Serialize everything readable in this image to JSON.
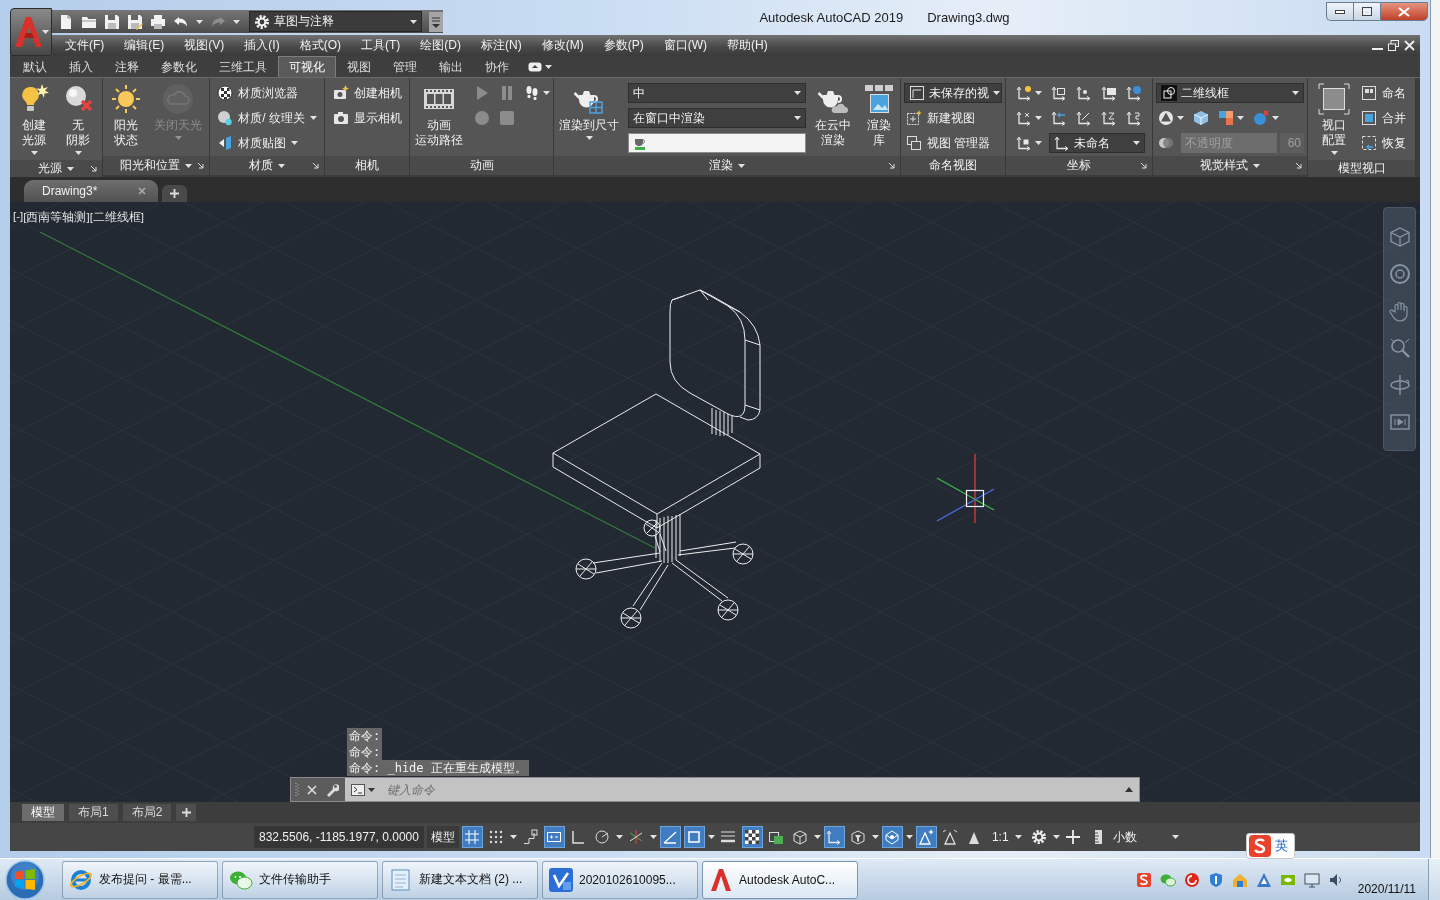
{
  "window": {
    "app_title": "Autodesk AutoCAD 2019",
    "file_title": "Drawing3.dwg"
  },
  "quick_access": {
    "workspace": "草图与注释"
  },
  "menu_bar": [
    "文件(F)",
    "编辑(E)",
    "视图(V)",
    "插入(I)",
    "格式(O)",
    "工具(T)",
    "绘图(D)",
    "标注(N)",
    "修改(M)",
    "参数(P)",
    "窗口(W)",
    "帮助(H)"
  ],
  "ribbon_tabs": [
    {
      "label": "默认",
      "selected": false
    },
    {
      "label": "插入",
      "selected": false
    },
    {
      "label": "注释",
      "selected": false
    },
    {
      "label": "参数化",
      "selected": false
    },
    {
      "label": "三维工具",
      "selected": false
    },
    {
      "label": "可视化",
      "selected": true
    },
    {
      "label": "视图",
      "selected": false
    },
    {
      "label": "管理",
      "selected": false
    },
    {
      "label": "输出",
      "selected": false
    },
    {
      "label": "协作",
      "selected": false
    }
  ],
  "ribbon_panels": [
    {
      "title": "光源",
      "menu": true,
      "launcher": true,
      "columns": [
        {
          "kind": "large",
          "lines": [
            "创建",
            "光源"
          ],
          "caret": true
        },
        {
          "kind": "large",
          "lines": [
            "无",
            "阴影"
          ],
          "caret": true
        }
      ]
    },
    {
      "title": "阳光和位置",
      "menu": true,
      "launcher": true,
      "columns": [
        {
          "kind": "large",
          "lines": [
            "阳光",
            "状态"
          ],
          "caret": false,
          "disabled": false
        },
        {
          "kind": "large",
          "lines": [
            "关闭天光"
          ],
          "caret": true,
          "disabled": true
        }
      ]
    },
    {
      "title": "材质",
      "menu": true,
      "launcher": true,
      "columns": [
        {
          "kind": "stack",
          "rows": [
            {
              "items": [
                {
                  "kind": "button",
                  "label": "材质浏览器",
                  "caret": false
                }
              ]
            },
            {
              "items": [
                {
                  "kind": "button",
                  "label": "材质/ 纹理关",
                  "caret": true
                }
              ]
            },
            {
              "items": [
                {
                  "kind": "button",
                  "label": "材质贴图",
                  "caret": true
                }
              ]
            }
          ]
        }
      ]
    },
    {
      "title": "相机",
      "menu": false,
      "launcher": false,
      "columns": [
        {
          "kind": "stack",
          "rows": [
            {
              "items": [
                {
                  "kind": "button",
                  "label": "创建相机",
                  "caret": false
                }
              ]
            },
            {
              "items": [
                {
                  "kind": "button",
                  "label": "显示相机",
                  "caret": false
                }
              ]
            }
          ]
        }
      ]
    },
    {
      "title": "动画",
      "menu": false,
      "launcher": false,
      "columns": [
        {
          "kind": "large",
          "lines": [
            "动画",
            "运动路径"
          ],
          "caret": false
        },
        {
          "kind": "stack",
          "rows": [
            {
              "items": [
                {
                  "kind": "button",
                  "caret": false,
                  "disabled": true
                },
                {
                  "kind": "button",
                  "caret": false,
                  "disabled": true
                },
                {
                  "kind": "button",
                  "caret": true,
                  "disabled": false
                }
              ]
            },
            {
              "items": [
                {
                  "kind": "button",
                  "caret": false,
                  "disabled": true
                },
                {
                  "kind": "button",
                  "caret": false,
                  "disabled": true
                }
              ]
            }
          ]
        }
      ]
    },
    {
      "title": "渲染",
      "menu": true,
      "launcher": true,
      "columns": [
        {
          "kind": "large",
          "lines": [
            "渲染到尺寸"
          ],
          "caret": true
        },
        {
          "kind": "stack",
          "rows": [
            {
              "items": [
                {
                  "kind": "dropdown",
                  "value": "中"
                }
              ]
            },
            {
              "items": [
                {
                  "kind": "dropdown",
                  "value": "在窗口中渲染"
                }
              ]
            },
            {
              "items": [
                {
                  "kind": "input"
                }
              ]
            }
          ]
        },
        {
          "kind": "large",
          "lines": [
            "在云中",
            "渲染"
          ],
          "caret": false
        },
        {
          "kind": "large",
          "lines": [
            "渲染",
            "库"
          ],
          "caret": false
        }
      ]
    },
    {
      "title": "命名视图",
      "menu": false,
      "launcher": false,
      "columns": [
        {
          "kind": "stack",
          "rows": [
            {
              "items": [
                {
                  "kind": "dropdown",
                  "value": "未保存的视"
                }
              ]
            },
            {
              "items": [
                {
                  "kind": "button",
                  "label": "新建视图",
                  "caret": false
                }
              ]
            },
            {
              "items": [
                {
                  "kind": "button",
                  "label": "视图 管理器",
                  "caret": false
                }
              ]
            }
          ]
        }
      ]
    },
    {
      "title": "坐标",
      "menu": false,
      "launcher": true,
      "columns": [
        {
          "kind": "stack",
          "rows": [
            {
              "items": [
                {
                  "kind": "button",
                  "caret": true
                },
                {
                  "kind": "button",
                  "caret": false
                },
                {
                  "kind": "button",
                  "caret": false
                },
                {
                  "kind": "button",
                  "caret": false
                },
                {
                  "kind": "button",
                  "caret": false
                }
              ]
            },
            {
              "items": [
                {
                  "kind": "button",
                  "caret": true
                },
                {
                  "kind": "button",
                  "caret": false
                },
                {
                  "kind": "button",
                  "caret": false
                },
                {
                  "kind": "button",
                  "caret": false
                },
                {
                  "kind": "button",
                  "caret": false
                }
              ]
            },
            {
              "items": [
                {
                  "kind": "button",
                  "caret": true
                },
                {
                  "kind": "dropdown",
                  "value": "未命名"
                }
              ]
            }
          ]
        }
      ]
    },
    {
      "title": "视觉样式",
      "menu": true,
      "launcher": true,
      "columns": [
        {
          "kind": "stack",
          "rows": [
            {
              "items": [
                {
                  "kind": "dropdown",
                  "value": "二维线框"
                }
              ]
            },
            {
              "items": [
                {
                  "kind": "button",
                  "caret": true
                },
                {
                  "kind": "button",
                  "caret": false
                },
                {
                  "kind": "button",
                  "caret": true
                },
                {
                  "kind": "button",
                  "caret": true
                }
              ]
            },
            {
              "items": [
                {
                  "kind": "button",
                  "caret": false,
                  "disabled": false
                },
                {
                  "kind": "field",
                  "label": "不透明度",
                  "value": "60",
                  "disabled": true
                }
              ]
            }
          ]
        }
      ]
    },
    {
      "title": "模型视口",
      "menu": false,
      "launcher": false,
      "columns": [
        {
          "kind": "large",
          "lines": [
            "视口",
            "配置"
          ],
          "caret": true
        },
        {
          "kind": "stack",
          "rows": [
            {
              "items": [
                {
                  "kind": "button",
                  "label": "命名",
                  "caret": false
                }
              ]
            },
            {
              "items": [
                {
                  "kind": "button",
                  "label": "合并",
                  "caret": false
                }
              ]
            },
            {
              "items": [
                {
                  "kind": "button",
                  "label": "恢复",
                  "caret": false
                }
              ]
            }
          ]
        }
      ]
    }
  ],
  "document_tabs": [
    {
      "label": "Drawing3*",
      "selected": true
    }
  ],
  "viewport": {
    "controls": [
      "[-]",
      "[西南等轴测]",
      "[二维线框]"
    ]
  },
  "command_history": [
    "命令:",
    "命令:",
    "命令: _hide 正在重生成模型。"
  ],
  "command_line": {
    "placeholder": "键入命令"
  },
  "layout_tabs": [
    {
      "label": "模型",
      "selected": true
    },
    {
      "label": "布局1",
      "selected": false
    },
    {
      "label": "布局2",
      "selected": false
    }
  ],
  "status_bar": {
    "items": [
      {
        "kind": "text",
        "value": "832.5506, -1185.1977, 0.0000"
      },
      {
        "kind": "button",
        "label": "模型"
      },
      {
        "kind": "toggle",
        "on": true,
        "caret": false
      },
      {
        "kind": "toggle",
        "on": false,
        "caret": true
      },
      {
        "kind": "toggle",
        "on": false,
        "caret": false
      },
      {
        "kind": "toggle",
        "on": true,
        "caret": false
      },
      {
        "kind": "toggle",
        "on": false,
        "caret": false
      },
      {
        "kind": "toggle",
        "on": false,
        "caret": true
      },
      {
        "kind": "toggle",
        "on": false,
        "caret": true
      },
      {
        "kind": "toggle",
        "on": true,
        "caret": false
      },
      {
        "kind": "toggle",
        "on": true,
        "caret": true
      },
      {
        "kind": "toggle",
        "on": false,
        "caret": false
      },
      {
        "kind": "toggle",
        "on": true,
        "caret": false
      },
      {
        "kind": "toggle",
        "on": false,
        "caret": false
      },
      {
        "kind": "toggle",
        "on": false,
        "caret": true
      },
      {
        "kind": "toggle",
        "on": true,
        "caret": false
      },
      {
        "kind": "toggle",
        "on": false,
        "caret": true
      },
      {
        "kind": "toggle",
        "on": true,
        "caret": true
      },
      {
        "kind": "toggle",
        "on": true,
        "caret": false
      },
      {
        "kind": "toggle",
        "on": false,
        "caret": false
      },
      {
        "kind": "toggle",
        "on": false,
        "caret": false
      },
      {
        "kind": "dropdown",
        "value": "1:1"
      },
      {
        "kind": "toggle",
        "on": false,
        "caret": true
      },
      {
        "kind": "toggle",
        "on": false,
        "caret": false
      },
      {
        "kind": "dropdown",
        "value": "小数"
      }
    ]
  },
  "ime": {
    "mode": "英"
  },
  "taskbar": {
    "tasks": [
      {
        "label": "发布提问 - 最需...",
        "selected": false
      },
      {
        "label": "文件传输助手",
        "selected": false
      },
      {
        "label": "新建文本文档 (2) ...",
        "selected": false
      },
      {
        "label": "2020102610095...",
        "selected": false
      },
      {
        "label": "Autodesk AutoC...",
        "selected": true
      }
    ],
    "date": "2020/11/11"
  }
}
